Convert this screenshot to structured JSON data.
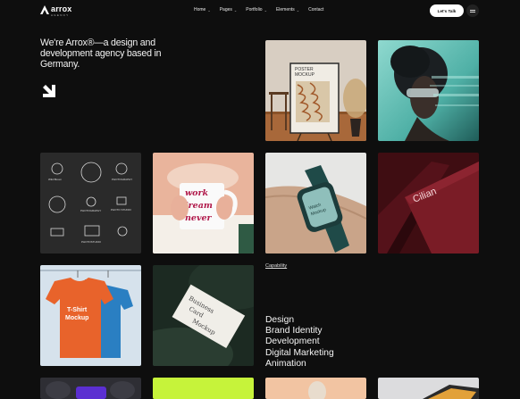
{
  "brand": {
    "name": "arrox",
    "tagline": "AGENCY"
  },
  "nav": {
    "items": [
      {
        "label": "Home",
        "has_dropdown": true
      },
      {
        "label": "Pages",
        "has_dropdown": true
      },
      {
        "label": "Portfolio",
        "has_dropdown": true
      },
      {
        "label": "Elements",
        "has_dropdown": true
      },
      {
        "label": "Contact",
        "has_dropdown": false
      }
    ],
    "cta_label": "Let's Talk",
    "menu_icon": "menu-icon"
  },
  "hero": {
    "headline": "We're Arrox®—a design and development agency based in Germany.",
    "arrow_icon": "arrow-down-right-icon"
  },
  "tiles": {
    "poster": {
      "text1": "POSTER",
      "text2": "MOCKUP"
    },
    "logos": {
      "items": [
        "Wild Bloom",
        "",
        "PHOTOGRAPHY",
        "",
        "PHOTOGRAPHY",
        "PHOTO STUDIO",
        "",
        "PHOTOSTUDIO",
        ""
      ]
    },
    "mug": {
      "lines": [
        "work",
        "dream",
        "never"
      ]
    },
    "watch": {
      "text1": "Watch",
      "text2": "Mockup"
    },
    "cilian": {
      "text": "Cilian"
    },
    "tshirt": {
      "text1": "T-Shirt",
      "text2": "Mockup"
    },
    "card": {
      "text1": "Business",
      "text2": "Card",
      "text3": "Mockup"
    }
  },
  "capability": {
    "link_label": "Capability",
    "services": [
      "Design",
      "Brand Identity",
      "Development",
      "Digital Marketing",
      "Animation"
    ]
  },
  "colors": {
    "background": "#0e0e0e",
    "accent": "#c6f33a",
    "text": "#ffffff"
  }
}
